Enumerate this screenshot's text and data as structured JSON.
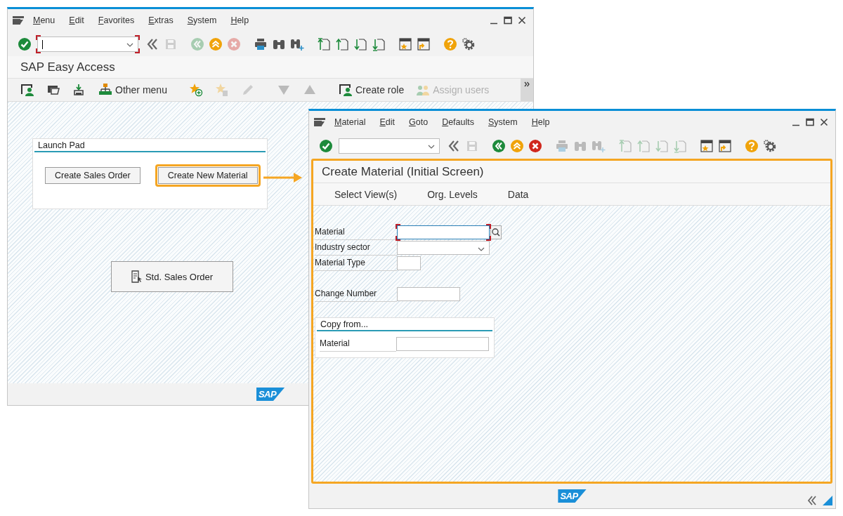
{
  "easy_access_window": {
    "menu": [
      {
        "label": "Menu"
      },
      {
        "label": "Edit"
      },
      {
        "label": "Favorites"
      },
      {
        "label": "Extras"
      },
      {
        "label": "System"
      },
      {
        "label": "Help"
      }
    ],
    "toolbar": [
      {
        "kind": "enter",
        "disabled": false
      },
      {
        "kind": "command",
        "focused": true
      },
      {
        "kind": "back-all",
        "disabled": false
      },
      {
        "kind": "save",
        "disabled": true
      },
      {
        "kind": "back",
        "disabled": true
      },
      {
        "kind": "exit",
        "disabled": false
      },
      {
        "kind": "cancel",
        "disabled": true
      },
      {
        "kind": "print",
        "disabled": false
      },
      {
        "kind": "find",
        "disabled": false
      },
      {
        "kind": "find-next",
        "disabled": false
      },
      {
        "kind": "first-page",
        "disabled": false
      },
      {
        "kind": "prev-page",
        "disabled": false
      },
      {
        "kind": "next-page",
        "disabled": false
      },
      {
        "kind": "last-page",
        "disabled": false
      },
      {
        "kind": "new-session",
        "disabled": false
      },
      {
        "kind": "shortcut",
        "disabled": false
      },
      {
        "kind": "help",
        "disabled": false
      },
      {
        "kind": "settings",
        "disabled": false
      }
    ],
    "title": "SAP Easy Access",
    "app_toolbar": [
      {
        "kind": "user-menu",
        "disabled": false
      },
      {
        "kind": "sap-menu",
        "disabled": false
      },
      {
        "kind": "download",
        "disabled": false
      },
      {
        "kind": "other-menu",
        "label": "Other menu",
        "disabled": false
      },
      {
        "kind": "add-favorite",
        "disabled": false
      },
      {
        "kind": "delete-favorite",
        "disabled": true
      },
      {
        "kind": "change-favorite",
        "disabled": true
      },
      {
        "kind": "move-down",
        "disabled": true
      },
      {
        "kind": "move-up",
        "disabled": true
      },
      {
        "kind": "create-role",
        "label": "Create role",
        "disabled": false
      },
      {
        "kind": "assign-users",
        "label": "Assign users",
        "disabled": true
      }
    ],
    "launch_pad": {
      "title": "Launch Pad",
      "buttons": [
        {
          "label": "Create Sales Order",
          "highlighted": false
        },
        {
          "label": "Create New Material",
          "highlighted": true
        }
      ]
    },
    "std_button": {
      "label": "Std. Sales Order"
    },
    "logo": "SAP"
  },
  "material_window": {
    "menu": [
      {
        "label": "Material"
      },
      {
        "label": "Edit"
      },
      {
        "label": "Goto"
      },
      {
        "label": "Defaults"
      },
      {
        "label": "System"
      },
      {
        "label": "Help"
      }
    ],
    "toolbar": [
      {
        "kind": "enter",
        "disabled": false
      },
      {
        "kind": "command",
        "focused": false
      },
      {
        "kind": "back-all",
        "disabled": false
      },
      {
        "kind": "save",
        "disabled": true
      },
      {
        "kind": "back",
        "disabled": false
      },
      {
        "kind": "exit",
        "disabled": false
      },
      {
        "kind": "cancel",
        "disabled": false
      },
      {
        "kind": "print",
        "disabled": true
      },
      {
        "kind": "find",
        "disabled": true
      },
      {
        "kind": "find-next",
        "disabled": true
      },
      {
        "kind": "first-page",
        "disabled": true
      },
      {
        "kind": "prev-page",
        "disabled": true
      },
      {
        "kind": "next-page",
        "disabled": true
      },
      {
        "kind": "last-page",
        "disabled": true
      },
      {
        "kind": "new-session",
        "disabled": false
      },
      {
        "kind": "shortcut",
        "disabled": false
      },
      {
        "kind": "help",
        "disabled": false
      },
      {
        "kind": "settings",
        "disabled": false
      }
    ],
    "screen": {
      "highlighted": true,
      "title": "Create Material (Initial Screen)",
      "app_toolbar": [
        {
          "label": "Select View(s)"
        },
        {
          "label": "Org. Levels"
        },
        {
          "label": "Data"
        }
      ],
      "field_groups": [
        [
          {
            "label": "Material",
            "kind": "search",
            "focused": true
          },
          {
            "label": "Industry sector",
            "kind": "dropdown",
            "focused": false
          },
          {
            "label": "Material Type",
            "kind": "short",
            "focused": false
          }
        ],
        [
          {
            "label": "Change Number",
            "kind": "medium",
            "focused": false
          }
        ]
      ],
      "copy_from": {
        "title": "Copy from...",
        "fields": [
          {
            "label": "Material",
            "kind": "text",
            "focused": false
          }
        ]
      }
    },
    "logo": "SAP"
  }
}
